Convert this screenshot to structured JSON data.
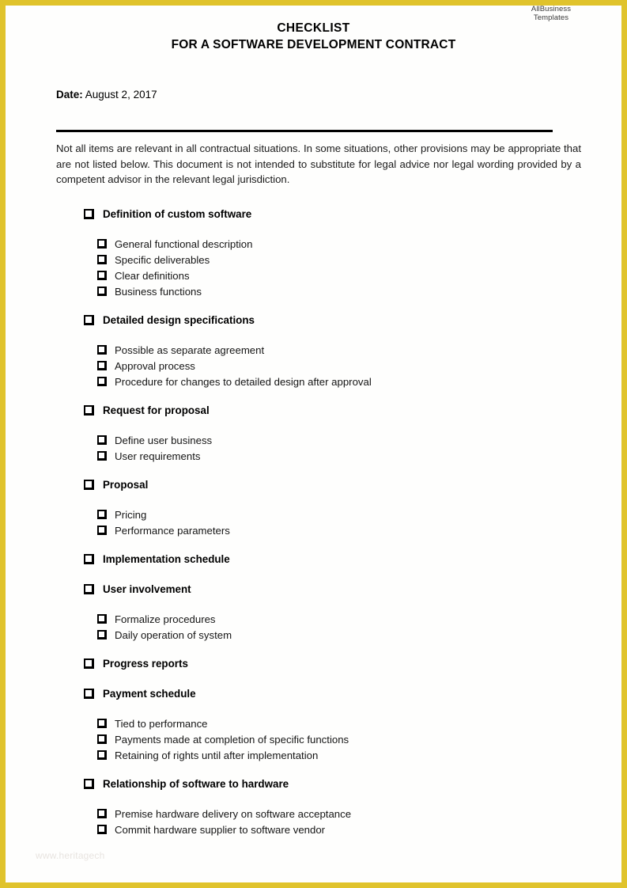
{
  "logo": {
    "line1": "AllBusiness",
    "line2": "Templates"
  },
  "title": {
    "line1": "CHECKLIST",
    "line2": "FOR A SOFTWARE DEVELOPMENT CONTRACT"
  },
  "date": {
    "label": "Date:",
    "value": "August 2, 2017"
  },
  "intro": "Not all items are relevant in all contractual situations. In some situations, other provisions may be appropriate that are not listed below. This document is not intended to substitute for legal advice nor legal wording provided by a competent advisor in the relevant legal jurisdiction.",
  "watermark": "www.heritagech",
  "colors": {
    "border": "#e0c32c",
    "rule": "#000000",
    "text": "#000000"
  },
  "checklist": [
    {
      "label": "Definition of custom software",
      "subitems": [
        "General functional description",
        "Specific deliverables",
        "Clear definitions",
        "Business functions"
      ]
    },
    {
      "label": "Detailed design specifications",
      "subitems": [
        "Possible as separate agreement",
        "Approval process",
        "Procedure for changes to detailed design after approval"
      ]
    },
    {
      "label": "Request for proposal",
      "subitems": [
        "Define user business",
        "User requirements"
      ]
    },
    {
      "label": "Proposal",
      "subitems": [
        "Pricing",
        "Performance parameters"
      ]
    },
    {
      "label": "Implementation schedule",
      "subitems": []
    },
    {
      "label": "User involvement",
      "subitems": [
        "Formalize procedures",
        "Daily operation of system"
      ]
    },
    {
      "label": "Progress reports",
      "subitems": []
    },
    {
      "label": "Payment schedule",
      "subitems": [
        "Tied to performance",
        "Payments made at completion of specific functions",
        "Retaining of rights until after implementation"
      ]
    },
    {
      "label": "Relationship of software to hardware",
      "subitems": [
        "Premise hardware delivery on software acceptance",
        "Commit hardware supplier to software vendor"
      ]
    }
  ]
}
